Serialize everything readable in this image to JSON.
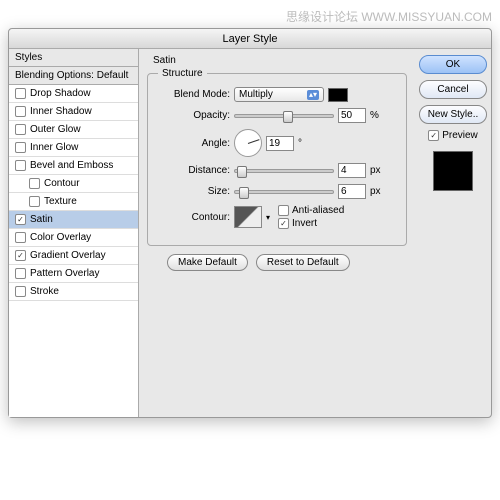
{
  "watermark": "思缘设计论坛   WWW.MISSYUAN.COM",
  "window_title": "Layer Style",
  "styles_header": "Styles",
  "blending_header": "Blending Options: Default",
  "styles": [
    {
      "label": "Drop Shadow",
      "checked": false
    },
    {
      "label": "Inner Shadow",
      "checked": false
    },
    {
      "label": "Outer Glow",
      "checked": false
    },
    {
      "label": "Inner Glow",
      "checked": false
    },
    {
      "label": "Bevel and Emboss",
      "checked": false
    },
    {
      "label": "Contour",
      "checked": false,
      "indent": true
    },
    {
      "label": "Texture",
      "checked": false,
      "indent": true
    },
    {
      "label": "Satin",
      "checked": true,
      "selected": true
    },
    {
      "label": "Color Overlay",
      "checked": false
    },
    {
      "label": "Gradient Overlay",
      "checked": true
    },
    {
      "label": "Pattern Overlay",
      "checked": false
    },
    {
      "label": "Stroke",
      "checked": false
    }
  ],
  "section_title": "Satin",
  "structure_title": "Structure",
  "blend_mode": {
    "label": "Blend Mode:",
    "value": "Multiply"
  },
  "opacity": {
    "label": "Opacity:",
    "value": "50",
    "unit": "%",
    "pos": 50
  },
  "angle": {
    "label": "Angle:",
    "value": "19",
    "unit": "°"
  },
  "distance": {
    "label": "Distance:",
    "value": "4",
    "unit": "px",
    "pos": 4
  },
  "size": {
    "label": "Size:",
    "value": "6",
    "unit": "px",
    "pos": 6
  },
  "contour": {
    "label": "Contour:",
    "anti": "Anti-aliased",
    "invert": "Invert",
    "invert_checked": true
  },
  "make_default": "Make Default",
  "reset_default": "Reset to Default",
  "buttons": {
    "ok": "OK",
    "cancel": "Cancel",
    "new_style": "New Style..",
    "preview": "Preview"
  }
}
